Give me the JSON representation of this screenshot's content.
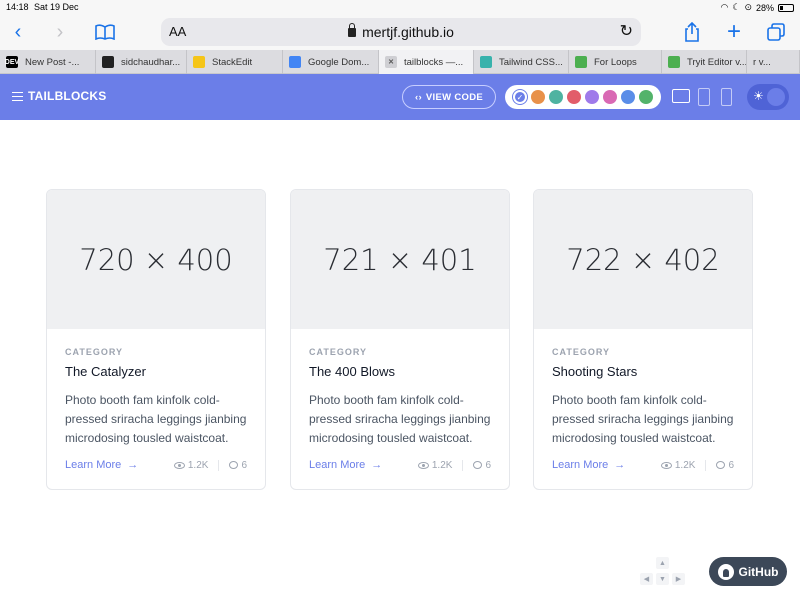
{
  "status": {
    "time": "14:18",
    "date": "Sat 19 Dec",
    "battery": "28%",
    "battery_level": 0.28
  },
  "toolbar": {
    "text_size_label": "AA",
    "url": "mertjf.github.io"
  },
  "tabs": [
    {
      "title": "New Post -...",
      "favicon": "dev-icon",
      "color": "#000000",
      "glyph": "DEV"
    },
    {
      "title": "sidchaudhar...",
      "favicon": "github-icon",
      "color": "#222222",
      "glyph": ""
    },
    {
      "title": "StackEdit",
      "favicon": "stackedit-icon",
      "color": "#f5c518",
      "glyph": ""
    },
    {
      "title": "Google Dom...",
      "favicon": "google-domains-icon",
      "color": "#4285f4",
      "glyph": ""
    },
    {
      "title": "tailblocks —...",
      "favicon": "close-icon",
      "color": "#777777",
      "glyph": "",
      "active": true
    },
    {
      "title": "Tailwind CSS...",
      "favicon": "tailwind-icon",
      "color": "#38b2ac",
      "glyph": ""
    },
    {
      "title": "For Loops",
      "favicon": "w3-icon",
      "color": "#4caf50",
      "glyph": ""
    },
    {
      "title": "Tryit Editor v...",
      "favicon": "w3-tryit-icon",
      "color": "#4caf50",
      "glyph": ""
    },
    {
      "title": "r v...",
      "favicon": "",
      "color": "",
      "glyph": ""
    }
  ],
  "nav": {
    "brand": "TAILBLOCKS",
    "view_code": "VIEW CODE",
    "swatches": [
      "#6b7ee8",
      "#e8914a",
      "#4fb3a1",
      "#e25d6a",
      "#9f7aea",
      "#d969b4",
      "#5a8de8",
      "#53b36a"
    ],
    "selected_swatch": 0
  },
  "cards": [
    {
      "image_label": "720 × 400",
      "category": "CATEGORY",
      "title": "The Catalyzer",
      "description": "Photo booth fam kinfolk cold-pressed sriracha leggings jianbing microdosing tousled waistcoat.",
      "link": "Learn More",
      "views": "1.2K",
      "comments": "6"
    },
    {
      "image_label": "721 × 401",
      "category": "CATEGORY",
      "title": "The 400 Blows",
      "description": "Photo booth fam kinfolk cold-pressed sriracha leggings jianbing microdosing tousled waistcoat.",
      "link": "Learn More",
      "views": "1.2K",
      "comments": "6"
    },
    {
      "image_label": "722 × 402",
      "category": "CATEGORY",
      "title": "Shooting Stars",
      "description": "Photo booth fam kinfolk cold-pressed sriracha leggings jianbing microdosing tousled waistcoat.",
      "link": "Learn More",
      "views": "1.2K",
      "comments": "6"
    }
  ],
  "github_button": "GitHub",
  "colors": {
    "accent": "#6b7ee8",
    "nav_bg": "#6b7ee8",
    "github_btn": "#3c4858"
  }
}
